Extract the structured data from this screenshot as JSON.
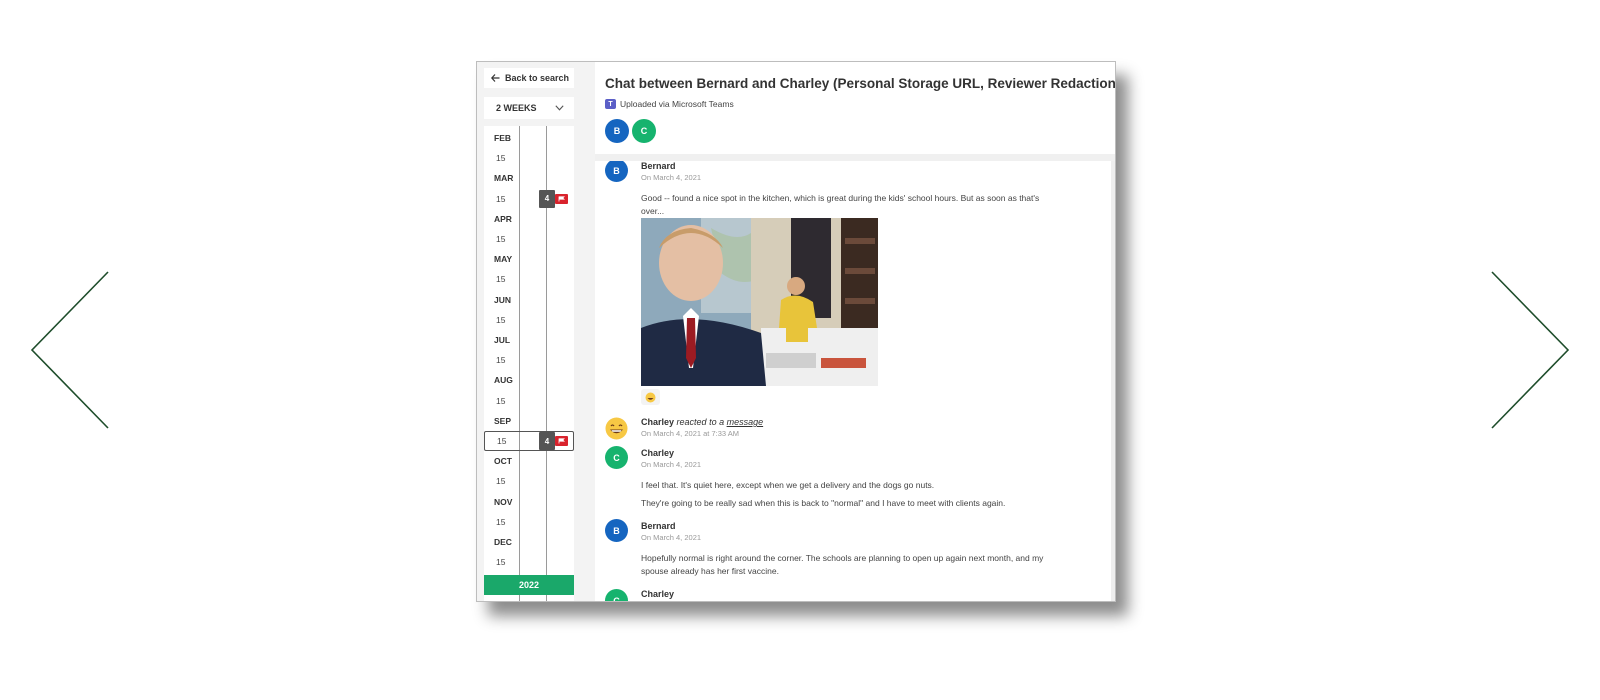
{
  "navigation": {
    "prev_label": "previous-arrow",
    "next_label": "next-arrow"
  },
  "sidebar": {
    "back_label": "Back to search",
    "range_label": "2 WEEKS",
    "timeline": [
      {
        "label": "FEB",
        "type": "month"
      },
      {
        "label": "15",
        "type": "day"
      },
      {
        "label": "MAR",
        "type": "month"
      },
      {
        "label": "15",
        "type": "day",
        "count": "4",
        "flag": true
      },
      {
        "label": "APR",
        "type": "month"
      },
      {
        "label": "15",
        "type": "day"
      },
      {
        "label": "MAY",
        "type": "month"
      },
      {
        "label": "15",
        "type": "day"
      },
      {
        "label": "JUN",
        "type": "month"
      },
      {
        "label": "15",
        "type": "day"
      },
      {
        "label": "JUL",
        "type": "month"
      },
      {
        "label": "15",
        "type": "day"
      },
      {
        "label": "AUG",
        "type": "month"
      },
      {
        "label": "15",
        "type": "day"
      },
      {
        "label": "SEP",
        "type": "month"
      },
      {
        "label": "15",
        "type": "day",
        "count": "4",
        "flag": true,
        "selected": true
      },
      {
        "label": "OCT",
        "type": "month"
      },
      {
        "label": "15",
        "type": "day"
      },
      {
        "label": "NOV",
        "type": "month"
      },
      {
        "label": "15",
        "type": "day"
      },
      {
        "label": "DEC",
        "type": "month"
      },
      {
        "label": "15",
        "type": "day"
      }
    ],
    "year_label": "2022"
  },
  "chat": {
    "title": "Chat between Bernard and Charley (Personal Storage URL, Reviewer Redactions)",
    "upload_note": "Uploaded via Microsoft Teams",
    "participants": [
      {
        "initial": "B",
        "color": "#1565c0"
      },
      {
        "initial": "C",
        "color": "#16b36e"
      }
    ],
    "messages": {
      "m1": {
        "initial": "B",
        "author": "Bernard",
        "date": "On March 4, 2021",
        "text": "Good -- found a nice spot in the kitchen, which is great during the kids' school hours.   But as soon as that's over..."
      },
      "reaction": {
        "author": "Charley",
        "verb": "reacted to a",
        "link": "message",
        "date": "On March 4, 2021 at 7:33 AM"
      },
      "m2": {
        "initial": "C",
        "author": "Charley",
        "date": "On March 4, 2021",
        "text1": "I feel that.  It's quiet here, except when we get a delivery and the dogs go nuts.",
        "text2": "They're going to be really sad when this is back to \"normal\" and I have to meet with clients again."
      },
      "m3": {
        "initial": "B",
        "author": "Bernard",
        "date": "On March 4, 2021",
        "text": "Hopefully normal is right around the corner.   The schools are planning to open up again next month, and my spouse already has her first vaccine."
      },
      "m4": {
        "initial": "C",
        "author": "Charley"
      }
    }
  },
  "colors": {
    "accent_green": "#1aa86a",
    "arrow_green": "#1e4d2b",
    "flag_red": "#d9232d",
    "avatar_blue": "#1565c0",
    "avatar_green": "#16b36e"
  }
}
